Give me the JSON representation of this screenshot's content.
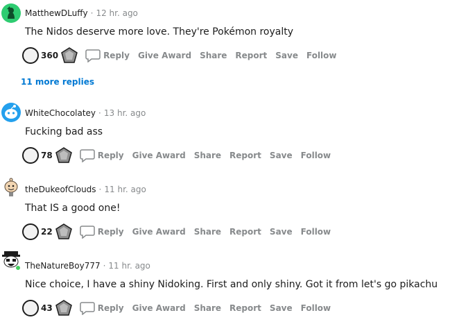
{
  "comments": [
    {
      "author": "MatthewDLuffy",
      "separator": "·",
      "time": "12 hr. ago",
      "body": "The Nidos deserve more love. They're Pokémon royalty",
      "score": "360"
    },
    {
      "author": "WhiteChocolatey",
      "separator": "·",
      "time": "13 hr. ago",
      "body": "Fucking bad ass",
      "score": "78"
    },
    {
      "author": "theDukeofClouds",
      "separator": "·",
      "time": "11 hr. ago",
      "body": "That IS a good one!",
      "score": "22"
    },
    {
      "author": "TheNatureBoy777",
      "separator": "·",
      "time": "11 hr. ago",
      "body": "Nice choice, I have a shiny Nidoking. First and only shiny. Got it from let's go pikachu",
      "score": "43"
    }
  ],
  "actions": {
    "reply": "Reply",
    "give_award": "Give Award",
    "share": "Share",
    "report": "Report",
    "save": "Save",
    "follow": "Follow"
  },
  "more_replies": "11 more replies",
  "colors": {
    "muted": "#878a8c",
    "link": "#0079d3",
    "avatar_green": "#2ecc71",
    "avatar_blue": "#24a0ed",
    "online": "#46d160"
  },
  "icons": {
    "vote": "vote-circle-icon",
    "award": "award-gem-icon",
    "reply": "reply-bubble-icon"
  }
}
